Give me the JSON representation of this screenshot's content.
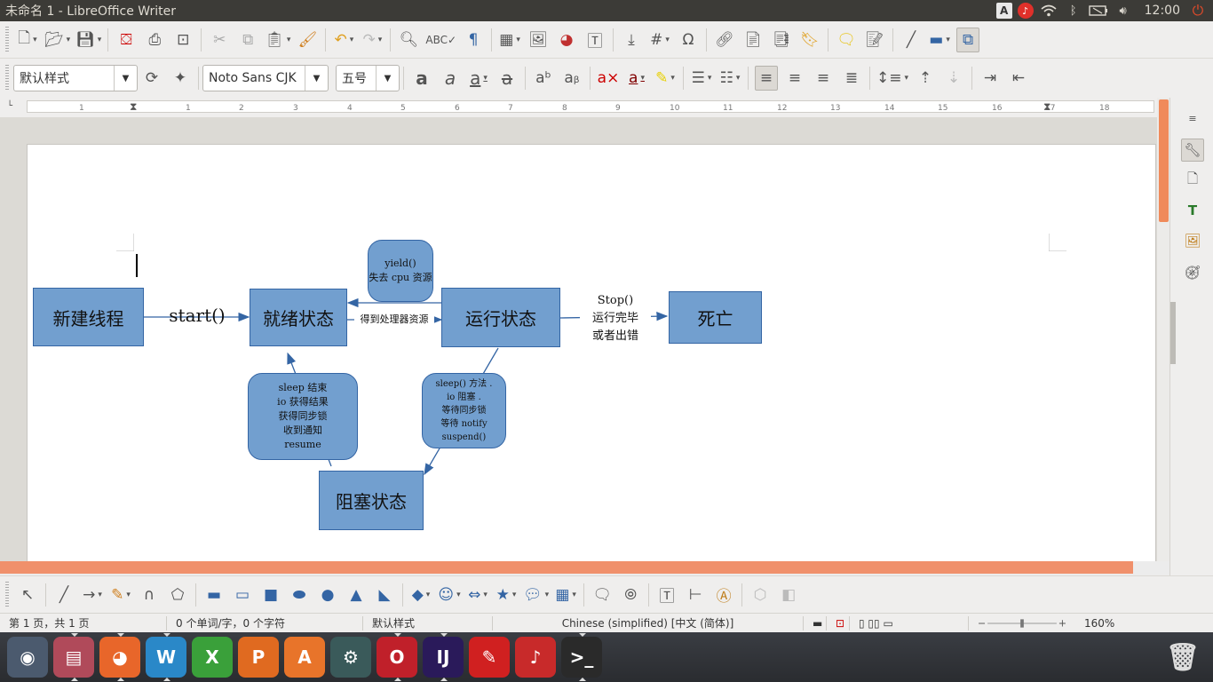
{
  "window": {
    "title": "未命名 1 - LibreOffice Writer"
  },
  "tray": {
    "keyboard": "A",
    "clock": "12:00"
  },
  "format_bar": {
    "paragraph_style": "默认样式",
    "font_name": "Noto Sans CJK",
    "font_size": "五号"
  },
  "ruler": {
    "numbers": [
      "1",
      "1",
      "2",
      "3",
      "4",
      "5",
      "6",
      "7",
      "8",
      "9",
      "10",
      "11",
      "12",
      "13",
      "14",
      "15",
      "16",
      "17",
      "18"
    ]
  },
  "diagram": {
    "new_thread": "新建线程",
    "start_label": "start()",
    "ready": "就绪状态",
    "running": "运行状态",
    "dead": "死亡",
    "blocked": "阻塞状态",
    "get_cpu_label": "得到处理器资源",
    "yield_box": [
      "yield()",
      "失去 cpu 资源"
    ],
    "stop_label": [
      "Stop()",
      "运行完毕",
      "或者出错"
    ],
    "sleep_end_box": [
      "sleep 结束",
      "io 获得结果",
      "获得同步锁",
      "收到通知",
      "resume"
    ],
    "sleep_box": [
      "sleep() 方法 .",
      "io 阻塞 .",
      "等待同步锁",
      "等待 notify",
      "suspend()"
    ]
  },
  "colors": {
    "shape_fill": "#729fcf",
    "shape_border": "#3465a4",
    "accent": "#f08a5a"
  },
  "statusbar": {
    "page": "第 1 页，共 1 页",
    "words": "0 个单词/字，0 个字符",
    "style": "默认样式",
    "language": "Chinese (simplified) [中文 (简体)]",
    "zoom": "160%"
  },
  "dock": {
    "items": [
      {
        "name": "dash",
        "label": "◉"
      },
      {
        "name": "files",
        "label": "▤"
      },
      {
        "name": "firefox",
        "label": "◕"
      },
      {
        "name": "writer",
        "label": "W"
      },
      {
        "name": "calc",
        "label": "X"
      },
      {
        "name": "impress",
        "label": "P"
      },
      {
        "name": "software-center",
        "label": "A"
      },
      {
        "name": "settings",
        "label": "⚙"
      },
      {
        "name": "opera",
        "label": "O"
      },
      {
        "name": "intellij",
        "label": "IJ"
      },
      {
        "name": "pdf",
        "label": "✎"
      },
      {
        "name": "music",
        "label": "♪"
      },
      {
        "name": "terminal",
        "label": ">_"
      }
    ]
  }
}
